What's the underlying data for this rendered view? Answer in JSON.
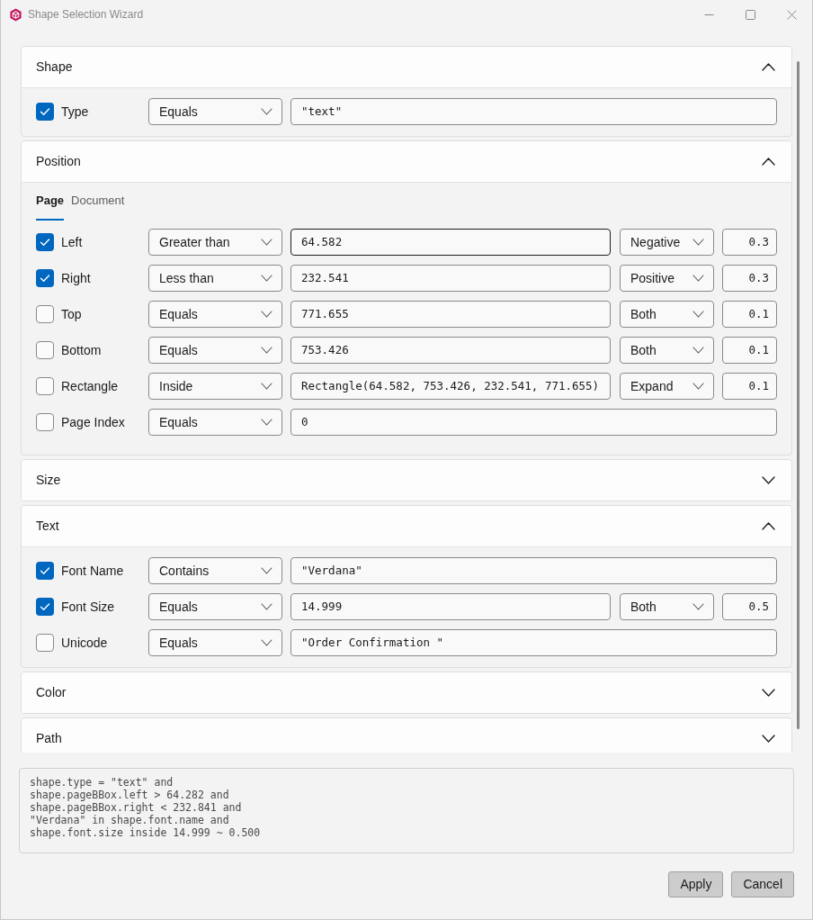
{
  "window": {
    "title": "Shape Selection Wizard"
  },
  "sections": [
    {
      "title": "Shape",
      "expanded": true,
      "rows": [
        {
          "label": "Type",
          "checked": true,
          "operator": "Equals",
          "value": "\"text\"",
          "focused": false
        }
      ]
    },
    {
      "title": "Position",
      "expanded": true,
      "tabs": [
        {
          "label": "Page",
          "selected": true
        },
        {
          "label": "Document",
          "selected": false
        }
      ],
      "rows": [
        {
          "label": "Left",
          "checked": true,
          "operator": "Greater than",
          "value": "64.582",
          "focused": true,
          "direction": "Negative",
          "tolerance": "0.3"
        },
        {
          "label": "Right",
          "checked": true,
          "operator": "Less than",
          "value": "232.541",
          "focused": false,
          "direction": "Positive",
          "tolerance": "0.3"
        },
        {
          "label": "Top",
          "checked": false,
          "operator": "Equals",
          "value": "771.655",
          "focused": false,
          "direction": "Both",
          "tolerance": "0.1"
        },
        {
          "label": "Bottom",
          "checked": false,
          "operator": "Equals",
          "value": "753.426",
          "focused": false,
          "direction": "Both",
          "tolerance": "0.1"
        },
        {
          "label": "Rectangle",
          "checked": false,
          "operator": "Inside",
          "value": "Rectangle(64.582, 753.426, 232.541, 771.655)",
          "focused": false,
          "direction": "Expand",
          "tolerance": "0.1"
        },
        {
          "label": "Page Index",
          "checked": false,
          "operator": "Equals",
          "value": "0",
          "focused": false
        }
      ]
    },
    {
      "title": "Size",
      "expanded": false
    },
    {
      "title": "Text",
      "expanded": true,
      "rows": [
        {
          "label": "Font Name",
          "checked": true,
          "operator": "Contains",
          "value": "\"Verdana\"",
          "focused": false
        },
        {
          "label": "Font Size",
          "checked": true,
          "operator": "Equals",
          "value": "14.999",
          "focused": false,
          "direction": "Both",
          "tolerance": "0.5"
        },
        {
          "label": "Unicode",
          "checked": false,
          "operator": "Equals",
          "value": "\"Order Confirmation \"",
          "focused": false
        }
      ]
    },
    {
      "title": "Color",
      "expanded": false
    },
    {
      "title": "Path",
      "expanded": false
    }
  ],
  "expression": "shape.type = \"text\" and\nshape.pageBBox.left > 64.282 and\nshape.pageBBox.right < 232.841 and\n\"Verdana\" in shape.font.name and\nshape.font.size inside 14.999 ~ 0.500",
  "buttons": [
    "Apply",
    "Cancel"
  ]
}
